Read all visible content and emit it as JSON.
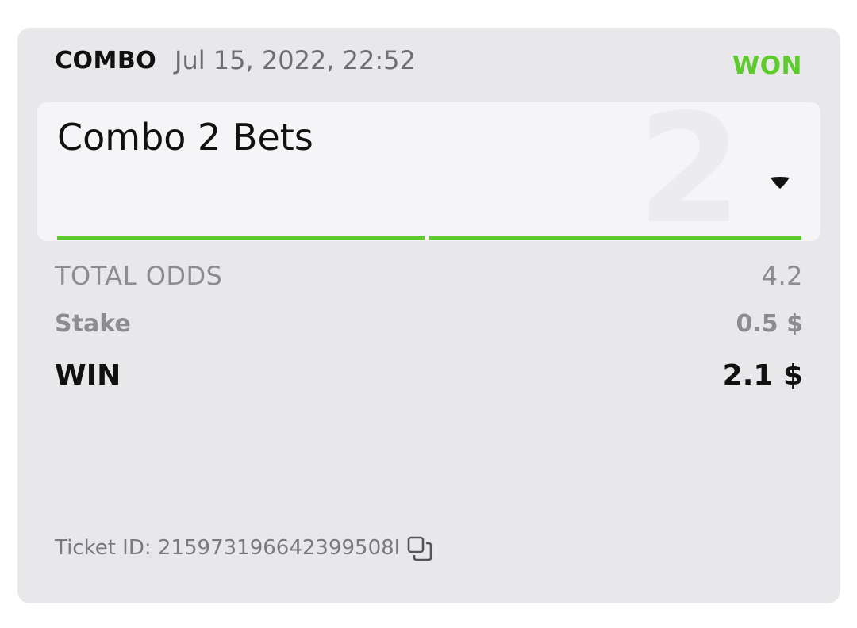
{
  "bet": {
    "type": "COMBO",
    "date": "Jul 15, 2022, 22:52",
    "status": "WON",
    "status_color": "#5ecb2c",
    "title": "Combo 2 Bets",
    "selection_count": "2",
    "progress_segments": [
      {
        "state": "won",
        "color": "#5ecb2c"
      },
      {
        "state": "won",
        "color": "#5ecb2c"
      }
    ],
    "expand_icon": "caret-down-icon"
  },
  "summary": {
    "odds_label": "TOTAL ODDS",
    "odds_value": "4.2",
    "stake_label": "Stake",
    "stake_value": "0.5 $",
    "win_label": "WIN",
    "win_value": "2.1 $"
  },
  "ticket": {
    "label": "Ticket ID: 215973196642399508I",
    "copy_icon": "copy-icon"
  }
}
